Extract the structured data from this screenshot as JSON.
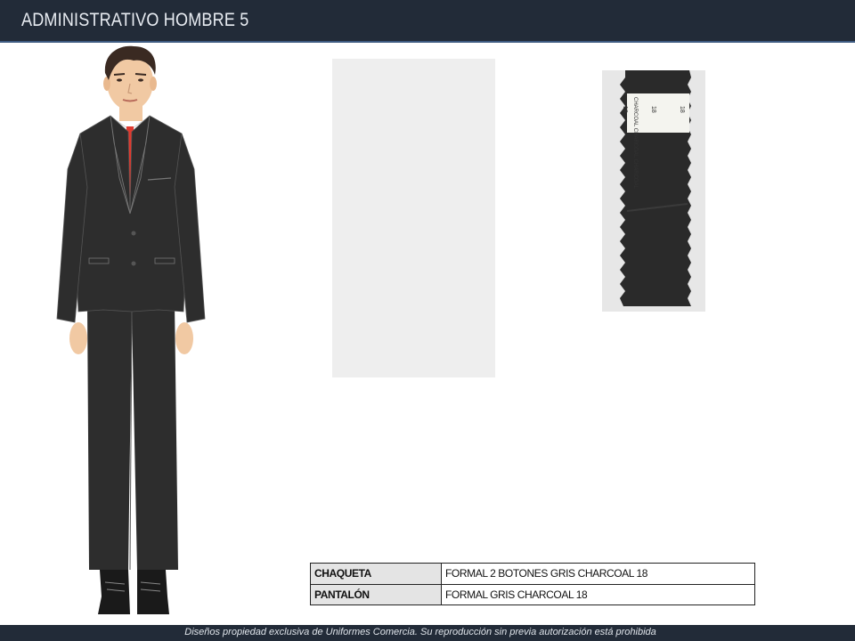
{
  "header": {
    "title": "ADMINISTRATIVO HOMBRE 5"
  },
  "figure": {
    "suit_color": "#2d2d2d",
    "tie_color": "#e03a2f",
    "skin_color": "#f1c9a3"
  },
  "swatch": {
    "fabric_color": "#2a2a2a",
    "label_line": "CHARCOAL CHARCOAL CHARCOAL",
    "label_numbers": [
      "18",
      "18",
      "18"
    ]
  },
  "spec_table": {
    "rows": [
      {
        "label": "CHAQUETA",
        "value": "FORMAL 2 BOTONES GRIS CHARCOAL 18"
      },
      {
        "label": "PANTALÓN",
        "value": "FORMAL GRIS CHARCOAL 18"
      }
    ]
  },
  "footer": {
    "text": "Diseños propiedad exclusiva de Uniformes Comercia. Su reproducción sin previa autorización está prohibida"
  }
}
